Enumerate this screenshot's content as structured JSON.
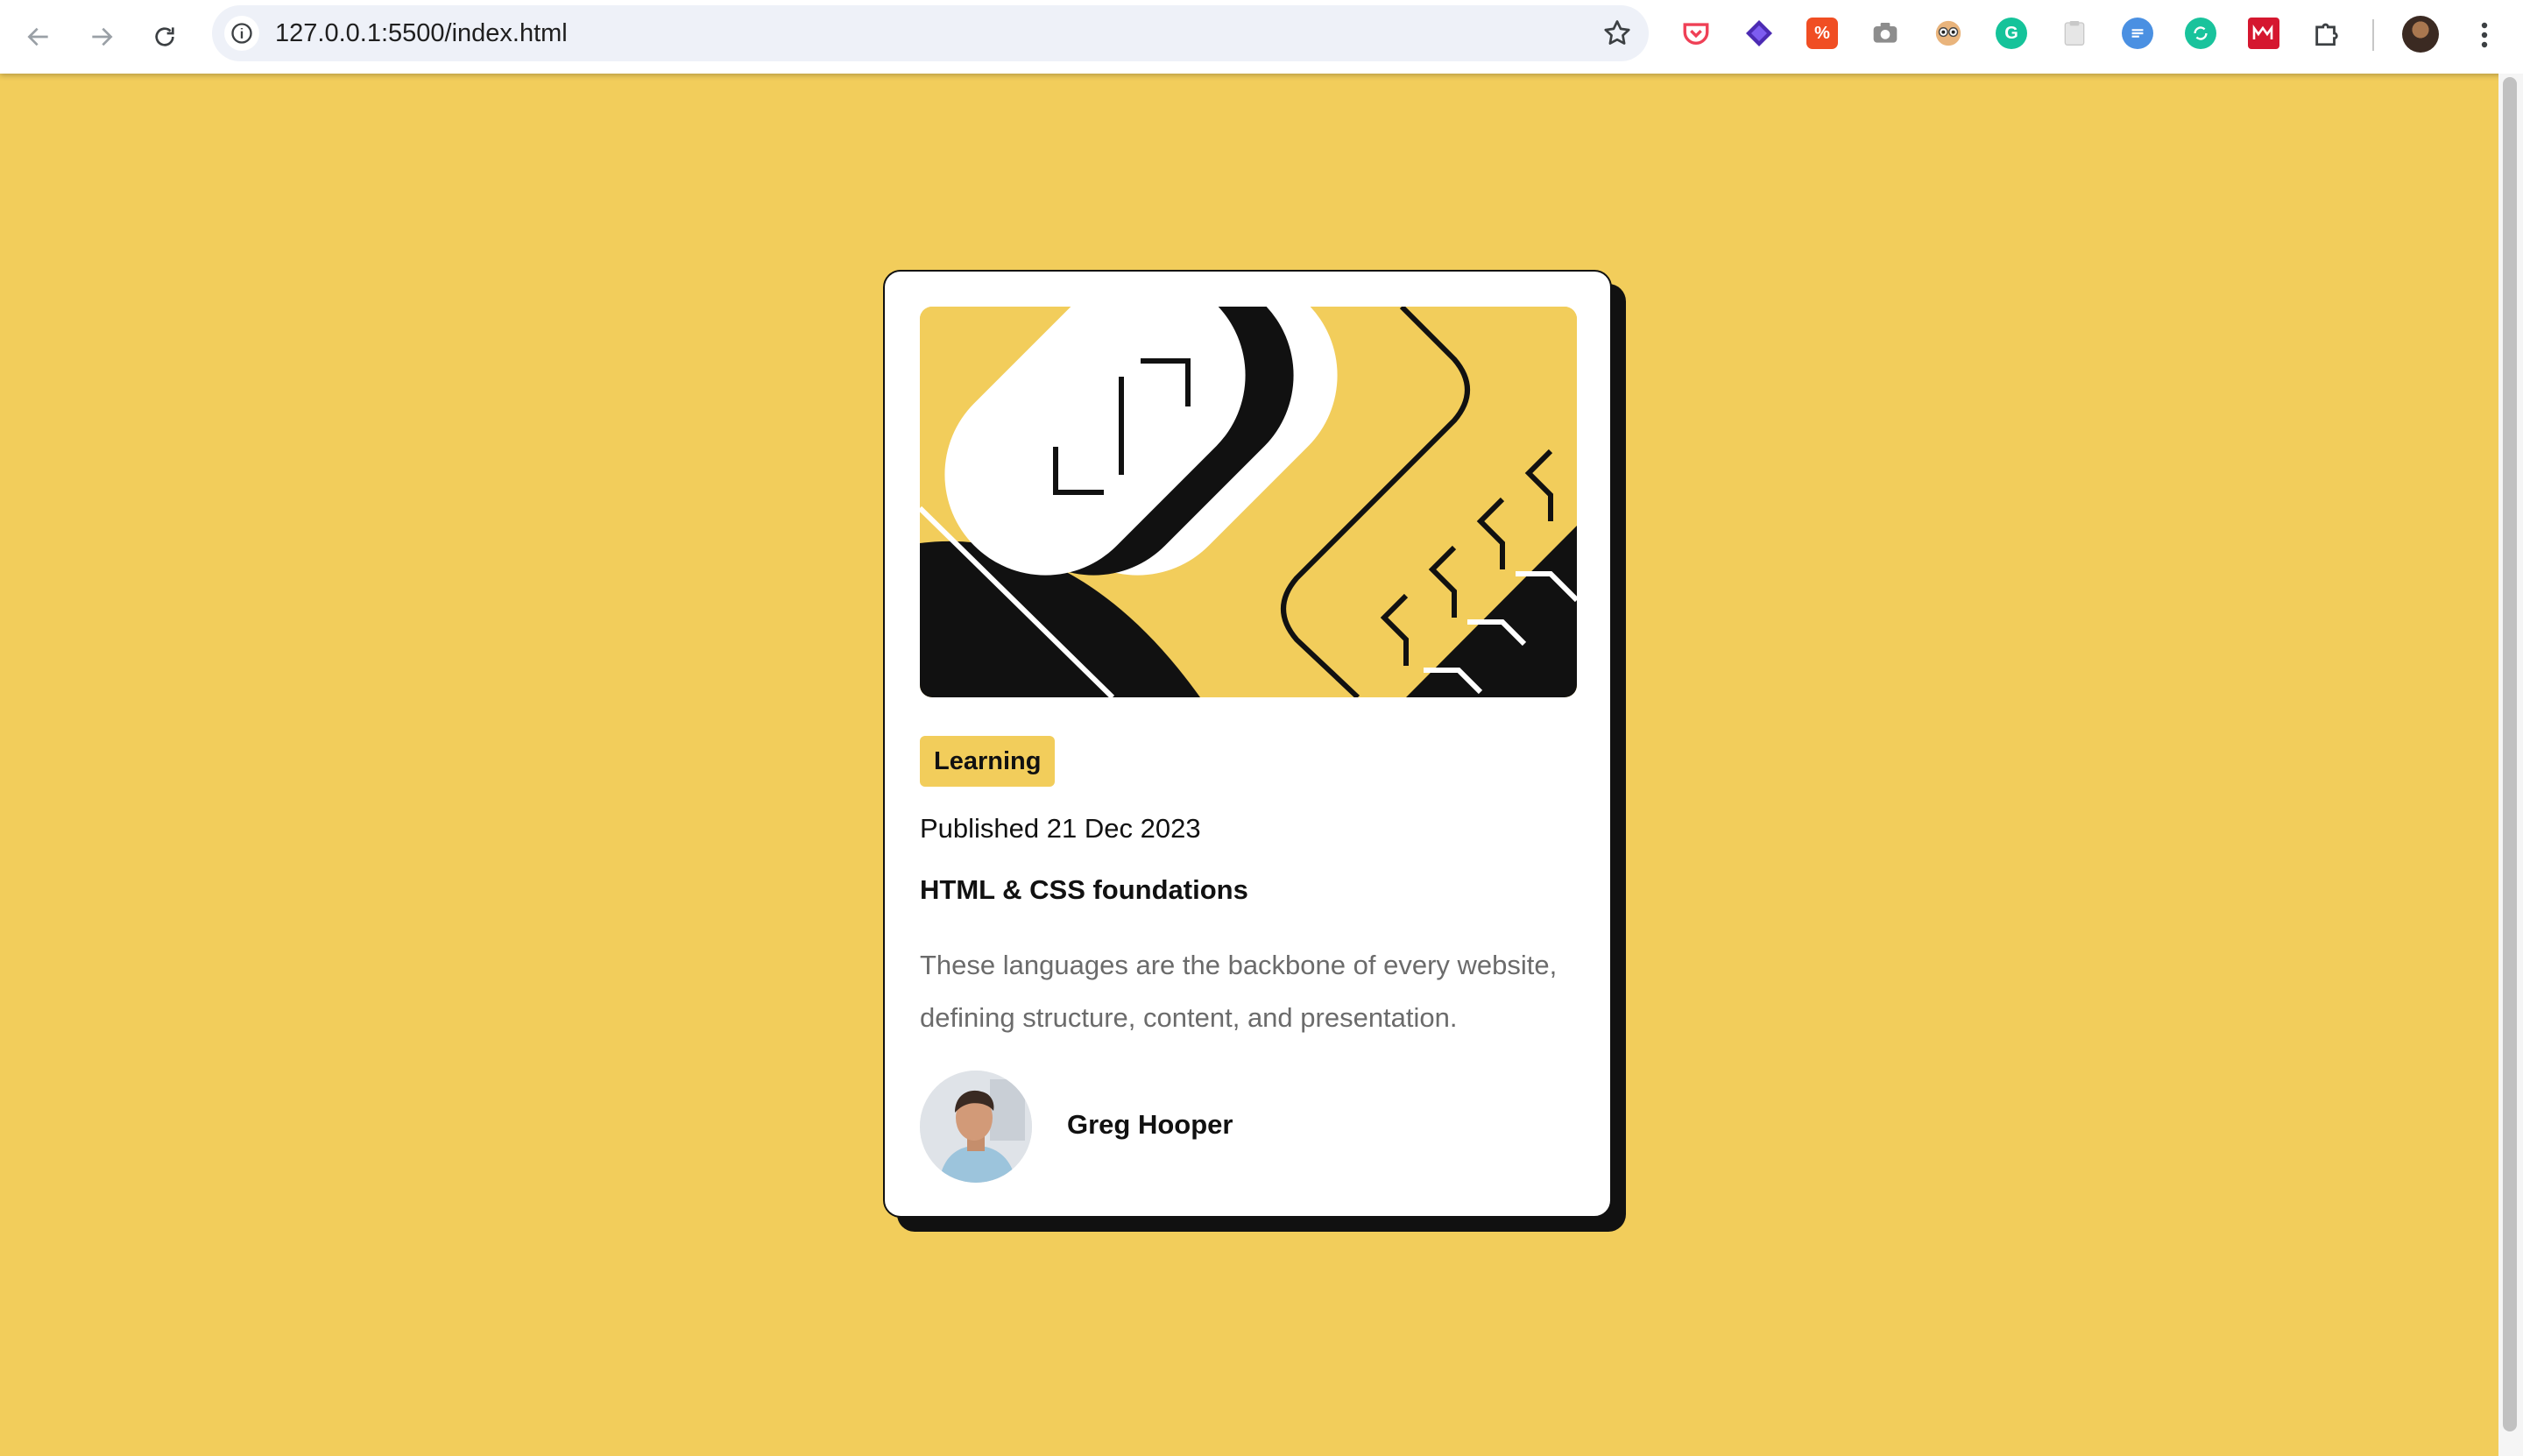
{
  "browser": {
    "url": "127.0.0.1:5500/index.html",
    "extensions": [
      {
        "name": "pocket-extension",
        "color": "#ef4056"
      },
      {
        "name": "stack-extension",
        "color": "#4c2bb3"
      },
      {
        "name": "translate-extension",
        "color": "#f04e23"
      },
      {
        "name": "camera-extension",
        "color": "#8d8d8d"
      },
      {
        "name": "owl-extension",
        "color": "#b87c4a"
      },
      {
        "name": "grammarly-extension",
        "color": "#15c39a"
      },
      {
        "name": "clipboard-extension",
        "color": "#dcdcdc"
      },
      {
        "name": "chat-extension",
        "color": "#4a90e2"
      },
      {
        "name": "sync-extension",
        "color": "#19c39c"
      },
      {
        "name": "mendeley-extension",
        "color": "#d5172f"
      }
    ]
  },
  "card": {
    "tag": "Learning",
    "published": "Published 21 Dec 2023",
    "title": "HTML & CSS foundations",
    "description": "These languages are the backbone of every website, defining structure, content, and presentation.",
    "author": "Greg Hooper"
  },
  "colors": {
    "background": "#f2cd5b",
    "card": "#ffffff",
    "ink": "#111111",
    "muted": "#6b6b6b"
  }
}
